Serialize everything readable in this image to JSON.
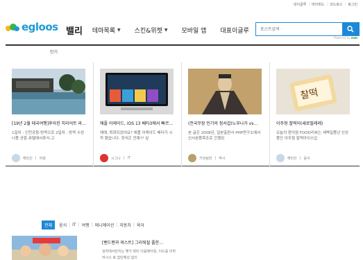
{
  "top_links": [
    "내이글루",
    "마이피드",
    "코드포스",
    "로그인"
  ],
  "logo": {
    "text": "egloos"
  },
  "nav": {
    "valley": "밸리",
    "items": [
      {
        "label": "테마목록",
        "has_chevron": true
      },
      {
        "label": "스킨&위젯",
        "has_chevron": true
      },
      {
        "label": "모바일 앱",
        "has_chevron": false
      },
      {
        "label": "대표이글루",
        "has_chevron": false
      }
    ]
  },
  "search": {
    "placeholder": "포스트검색 ·",
    "button_icon": "search-icon"
  },
  "powered": {
    "prefix": "Powered by",
    "brand": "zum"
  },
  "tab_label": "인기",
  "cards": [
    {
      "title": "[19년 2월 태국여행]후아힌 히리어트 라…",
      "desc": "1일차 : 인천공항-방콕으로 2일차 : 방콕 수완나품 공항-호텔에서휴식-고",
      "author": "해피진",
      "category": "여행",
      "thumb": "hotel-pool"
    },
    {
      "title": "애플 아케이드, iOS 13 베타3에서 빠르…",
      "desc": "예예, 퇴화되었어요? 애플 아케이드 베타가 시작 됐습니다. 정식은 언제?? 싶",
      "author": "시그나",
      "category": "IT",
      "thumb": "apple-arcade"
    },
    {
      "title": "(전국무장 인기의 정서겁)노부나가 vs…",
      "desc": "본 글은 2008년, 일본출판사 PHP연구소에서 신서본품목조로 간행된",
      "author": "키와림방",
      "category": "역사",
      "thumb": "samurai-portrait"
    },
    {
      "title": "이주형 찰떡이(새로필레레)",
      "desc": "오늘의 편의점 FOOD리뷰는 새벽일품년 신상품인 아주형 찰떡아이스입",
      "author": "해피진",
      "category": "음식",
      "thumb": "ice-cream"
    }
  ],
  "categories": {
    "active": "전체",
    "items": [
      "음식",
      "IT",
      "여행",
      "애니메이션",
      "자동차",
      "육아"
    ]
  },
  "bottom_post": {
    "title": "[밴드맨과 와스트] 그리워질 플한…",
    "desc": "심하에서린지는 몇가 파티 다음에아침, 이드를 더하려시스 로 집단예성 집이"
  }
}
